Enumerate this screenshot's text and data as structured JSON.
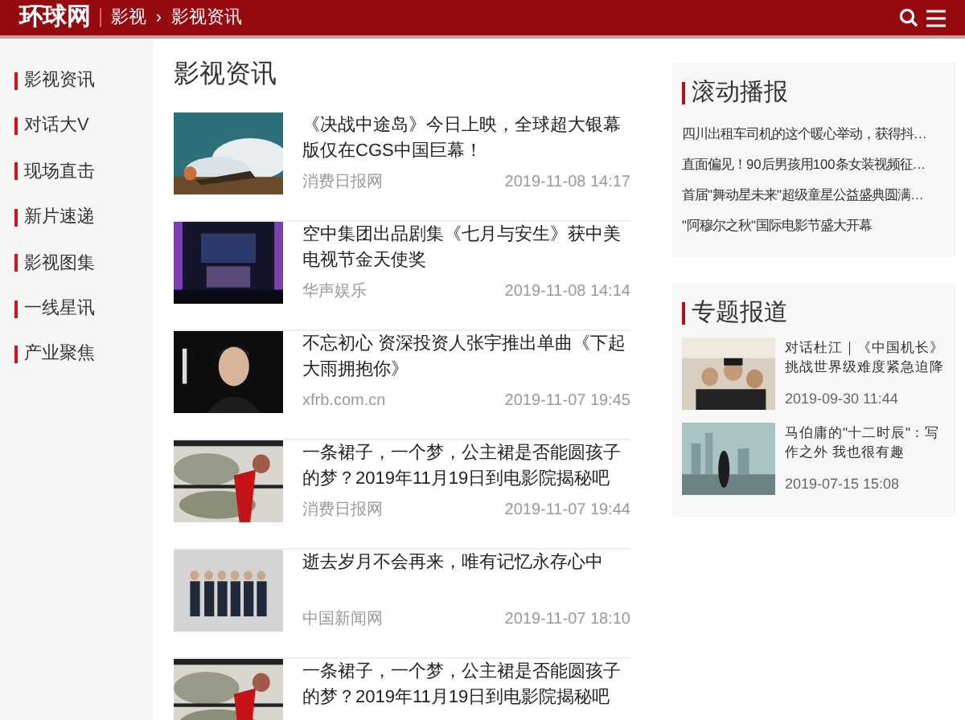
{
  "header": {
    "logo": "环球网",
    "breadcrumb": [
      "影视",
      "影视资讯"
    ],
    "separator": "›"
  },
  "sidebar": {
    "items": [
      "影视资讯",
      "对话大V",
      "现场直击",
      "新片速递",
      "影视图集",
      "一线星讯",
      "产业聚焦"
    ]
  },
  "main": {
    "title": "影视资讯",
    "articles": [
      {
        "title": "《决战中途岛》今日上映，全球超大银幕版仅在CGS中国巨幕！",
        "source": "消费日报网",
        "time": "2019-11-08 14:17"
      },
      {
        "title": "空中集团出品剧集《七月与安生》获中美电视节金天使奖",
        "source": "华声娱乐",
        "time": "2019-11-08 14:14"
      },
      {
        "title": "不忘初心 资深投资人张宇推出单曲《下起大雨拥抱你》",
        "source": "xfrb.com.cn",
        "time": "2019-11-07 19:45"
      },
      {
        "title": "一条裙子，一个梦，公主裙是否能圆孩子的梦？2019年11月19日到电影院揭秘吧",
        "source": "消费日报网",
        "time": "2019-11-07 19:44"
      },
      {
        "title": "逝去岁月不会再来，唯有记忆永存心中",
        "source": "中国新闻网",
        "time": "2019-11-07 18:10"
      },
      {
        "title": "一条裙子，一个梦，公主裙是否能圆孩子的梦？2019年11月19日到电影院揭秘吧"
      }
    ]
  },
  "ticker": {
    "title": "滚动播报",
    "items": [
      "四川出租车司机的这个暖心举动，获得抖…",
      "直面偏见！90后男孩用100条女装视频征…",
      "首届\"舞动星未来\"超级童星公益盛典圆满…",
      "\"阿穆尔之秋\"国际电影节盛大开幕"
    ]
  },
  "topics": {
    "title": "专题报道",
    "items": [
      {
        "title": "对话杜江｜《中国机长》挑战世界级难度紧急迫降",
        "time": "2019-09-30 11:44"
      },
      {
        "title": "马伯庸的\"十二时辰\"：写作之外 我也很有趣",
        "time": "2019-07-15 15:08"
      }
    ]
  }
}
